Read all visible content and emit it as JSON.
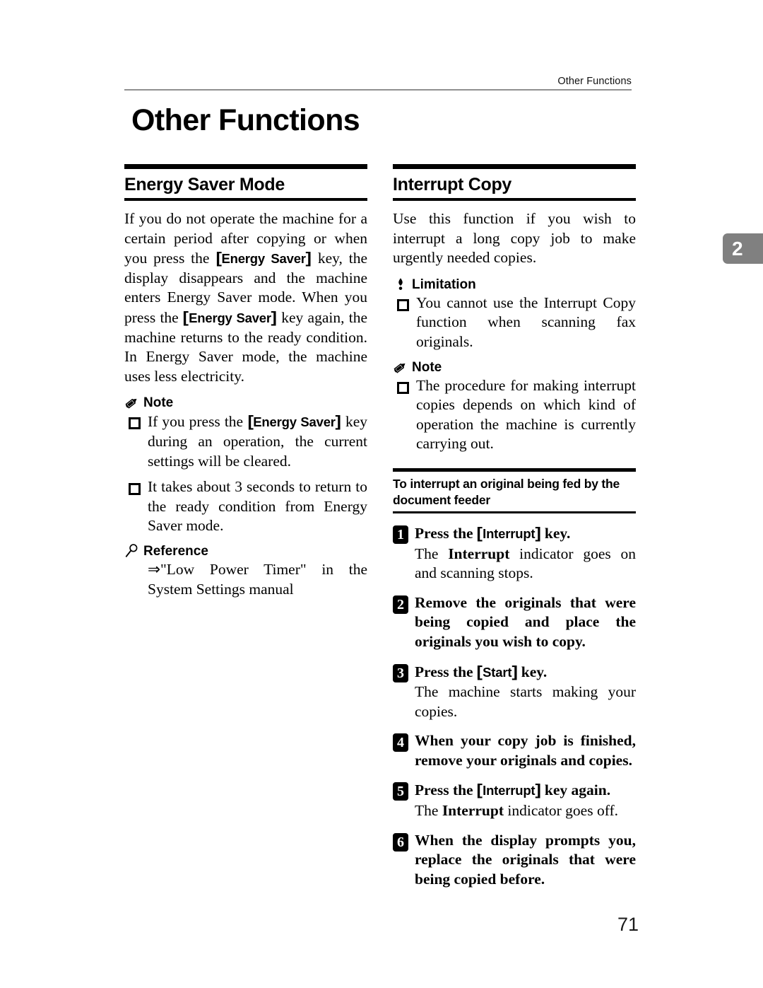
{
  "header": {
    "running_head": "Other Functions"
  },
  "chapter_tab": {
    "number": "2",
    "color": "#808080"
  },
  "chapter_title": "Other Functions",
  "page_number": "71",
  "left_column": {
    "section": {
      "title": "Energy Saver Mode",
      "intro_part1": "If you do not operate the machine for a certain period after copying or when you press the ",
      "key1": "Energy Saver",
      "intro_part2": " key, the display disappears and the machine enters Energy Saver mode. When you press the ",
      "key2": "Energy Saver",
      "intro_part3": " key again, the machine returns to the ready condition. In Energy Saver mode, the machine uses less electricity."
    },
    "note": {
      "icon": "pencil-icon",
      "label": "Note",
      "items": [
        {
          "text_part1": "If you press the ",
          "key": "Energy Saver",
          "text_part2": " key during an operation, the current settings will be cleared."
        },
        {
          "text_part1": "It takes about 3 seconds to return to the ready condition from Energy Saver mode.",
          "key": "",
          "text_part2": ""
        }
      ]
    },
    "reference": {
      "icon": "magnifier-icon",
      "label": "Reference",
      "body": "⇒\"Low Power Timer\" in the System Settings manual"
    }
  },
  "right_column": {
    "section": {
      "title": "Interrupt Copy",
      "intro": "Use this function if you wish to interrupt a long copy job to make urgently needed copies."
    },
    "limitation": {
      "icon": "exclamation-icon",
      "label": "Limitation",
      "items": [
        "You cannot use the Interrupt Copy function when scanning fax originals."
      ]
    },
    "note": {
      "icon": "pencil-icon",
      "label": "Note",
      "items": [
        "The procedure for making interrupt copies depends on which kind of operation the machine is currently carrying out."
      ]
    },
    "subsection": {
      "title": "To interrupt an original being fed by the document feeder",
      "steps": [
        {
          "number": "1",
          "title_part1": "Press the ",
          "key": "Interrupt",
          "title_part2": " key.",
          "detail_part1": "The ",
          "detail_bold": "Interrupt",
          "detail_part2": " indicator goes on and scanning stops."
        },
        {
          "number": "2",
          "title_part1": "Remove the originals that were being copied and place the originals you wish to copy.",
          "key": "",
          "title_part2": "",
          "detail_part1": "",
          "detail_bold": "",
          "detail_part2": ""
        },
        {
          "number": "3",
          "title_part1": "Press the ",
          "key": "Start",
          "title_part2": " key.",
          "detail_part1": "The machine starts making your copies.",
          "detail_bold": "",
          "detail_part2": ""
        },
        {
          "number": "4",
          "title_part1": "When your copy job is finished, remove your originals and copies.",
          "key": "",
          "title_part2": "",
          "detail_part1": "",
          "detail_bold": "",
          "detail_part2": ""
        },
        {
          "number": "5",
          "title_part1": "Press the ",
          "key": "Interrupt",
          "title_part2": " key again.",
          "detail_part1": "The ",
          "detail_bold": "Interrupt",
          "detail_part2": " indicator goes off."
        },
        {
          "number": "6",
          "title_part1": "When the display prompts you, replace the originals that were being copied before.",
          "key": "",
          "title_part2": "",
          "detail_part1": "",
          "detail_bold": "",
          "detail_part2": ""
        }
      ]
    }
  }
}
